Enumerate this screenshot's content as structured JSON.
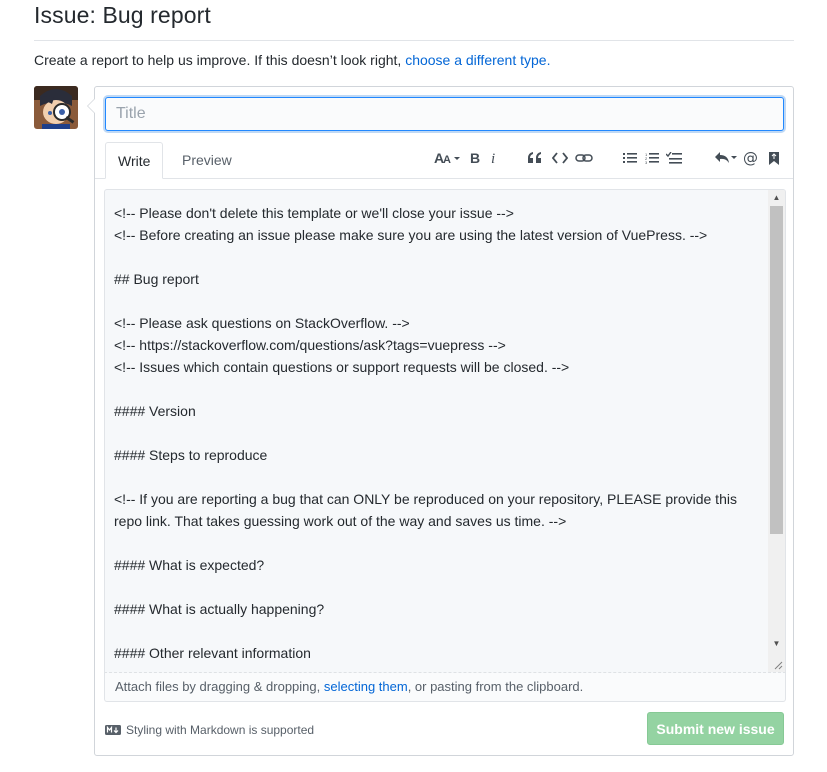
{
  "page": {
    "title": "Issue: Bug report",
    "subtitle_text": "Create a report to help us improve. If this doesn’t look right, ",
    "subtitle_link": "choose a different type."
  },
  "form": {
    "title_placeholder": "Title",
    "tabs": [
      {
        "label": "Write",
        "active": true
      },
      {
        "label": "Preview",
        "active": false
      }
    ],
    "toolbar": [
      "text-size-icon",
      "bold-icon",
      "italic-icon",
      "quote-icon",
      "code-icon",
      "link-icon",
      "bullet-list-icon",
      "numbered-list-icon",
      "task-list-icon",
      "reply-icon",
      "mention-icon",
      "bookmark-icon"
    ],
    "body_text": "<!-- Please don't delete this template or we'll close your issue -->\n<!-- Before creating an issue please make sure you are using the latest version of VuePress. -->\n\n## Bug report\n\n<!-- Please ask questions on StackOverflow. -->\n<!-- https://stackoverflow.com/questions/ask?tags=vuepress -->\n<!-- Issues which contain questions or support requests will be closed. -->\n\n#### Version\n\n#### Steps to reproduce\n\n<!-- If you are reporting a bug that can ONLY be reproduced on your repository, PLEASE provide this repo link. That takes guessing work out of the way and saves us time. -->\n\n#### What is expected?\n\n#### What is actually happening?\n\n#### Other relevant information",
    "attach_prefix": "Attach files by dragging & dropping, ",
    "attach_link": "selecting them",
    "attach_suffix": ", or pasting from the clipboard.",
    "markdown_note": "Styling with Markdown is supported",
    "submit_label": "Submit new issue"
  },
  "colors": {
    "link": "#0366d6",
    "submit_disabled": "#94d3a2",
    "focus_border": "#2188ff"
  }
}
